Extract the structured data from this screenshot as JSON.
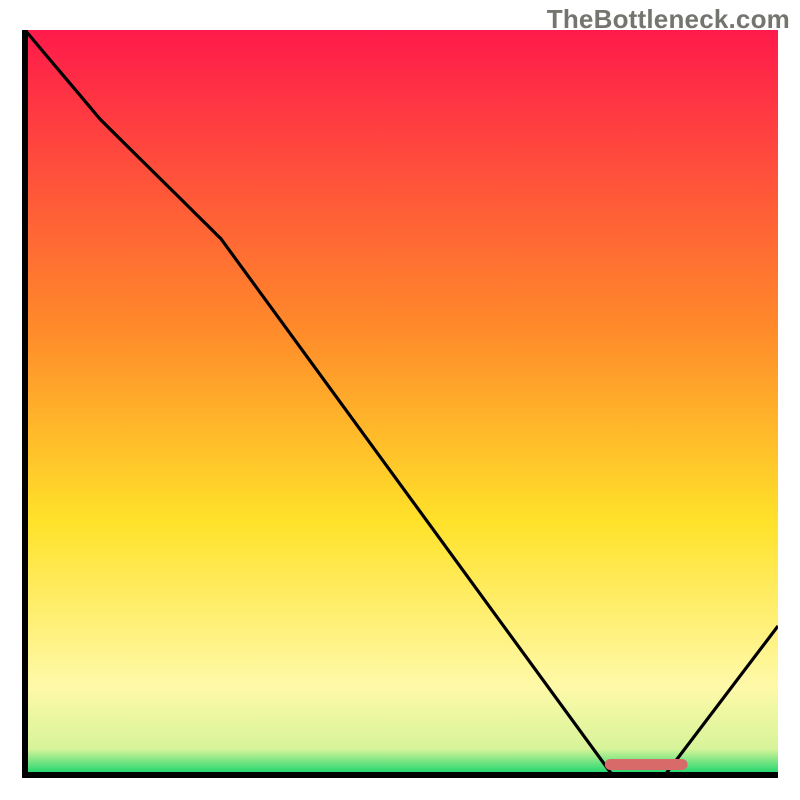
{
  "watermark": "TheBottleneck.com",
  "colors": {
    "gradient_top": "#ff1a4b",
    "gradient_mid_upper": "#ff8a2a",
    "gradient_mid": "#ffe22a",
    "gradient_lower": "#fff9a8",
    "gradient_bottom": "#11d46a",
    "axis": "#000000",
    "curve": "#000000",
    "marker": "#d96a6a"
  },
  "chart_data": {
    "type": "line",
    "title": "",
    "xlabel": "",
    "ylabel": "",
    "xlim": [
      0,
      100
    ],
    "ylim": [
      0,
      100
    ],
    "x": [
      0,
      10,
      26,
      78,
      85,
      100
    ],
    "values": [
      100,
      88,
      72,
      0,
      0,
      20
    ],
    "annotations": [
      {
        "name": "bottleneck-range",
        "x_start": 77,
        "x_end": 88,
        "y": 0
      }
    ]
  }
}
